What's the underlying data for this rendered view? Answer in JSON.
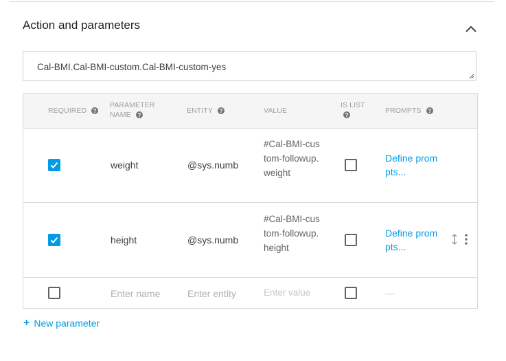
{
  "section": {
    "title": "Action and parameters",
    "action_value": "Cal-BMI.Cal-BMI-custom.Cal-BMI-custom-yes"
  },
  "table": {
    "headers": {
      "required": "REQUIRED",
      "parameter_name_line1": "PARAMETER",
      "parameter_name_line2": "NAME",
      "entity": "ENTITY",
      "value": "VALUE",
      "is_list_line1": "IS LIST",
      "prompts": "PROMPTS"
    },
    "rows": [
      {
        "required": true,
        "name": "weight",
        "entity": "@sys.number",
        "value": "#Cal-BMI-custom-followup.weight",
        "is_list": false,
        "prompts": "Define prompts..."
      },
      {
        "required": true,
        "name": "height",
        "entity": "@sys.number",
        "value": "#Cal-BMI-custom-followup.height",
        "is_list": false,
        "prompts": "Define prompts..."
      }
    ],
    "new_row": {
      "name_placeholder": "Enter name",
      "entity_placeholder": "Enter entity",
      "value_placeholder": "Enter value",
      "prompts_placeholder": "—"
    }
  },
  "new_parameter_label": "New parameter",
  "icons": {
    "collapse": "chevron-up-icon",
    "help": "help-circle-icon",
    "drag": "vertical-drag-icon",
    "menu": "more-vertical-icon",
    "add": "plus-icon"
  },
  "colors": {
    "accent": "#039be5",
    "header_bg": "#f5f5f5",
    "border": "#d9d9d9"
  }
}
